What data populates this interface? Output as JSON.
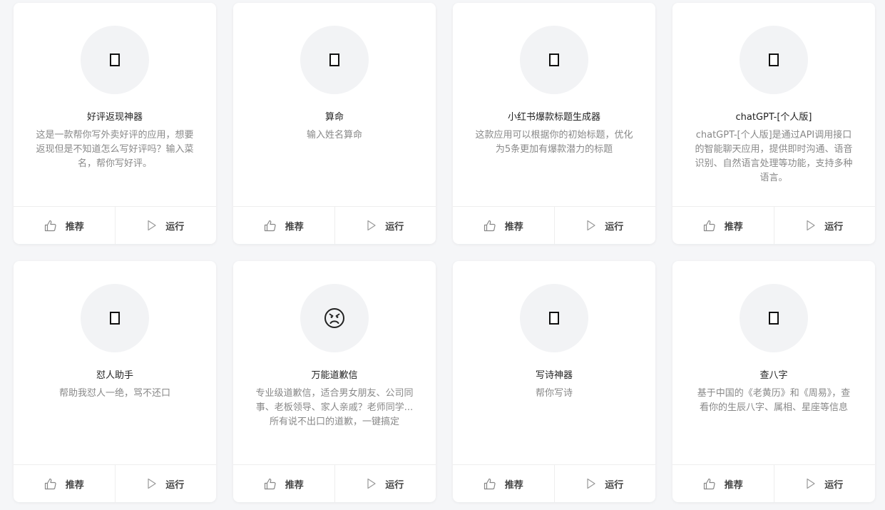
{
  "ui": {
    "recommend_label": "推荐",
    "run_label": "运行",
    "accent": "#f2f3f5"
  },
  "apps": [
    {
      "title": "好评返现神器",
      "desc": "这是一款帮你写外卖好评的应用，想要返现但是不知道怎么写好评吗？输入菜名，帮你写好评。",
      "icon": "emoji-icon"
    },
    {
      "title": "算命",
      "desc": "输入姓名算命",
      "icon": "emoji-icon"
    },
    {
      "title": "小红书爆款标题生成器",
      "desc": "这款应用可以根据你的初始标题，优化为5条更加有爆款潜力的标题",
      "icon": "emoji-icon"
    },
    {
      "title": "chatGPT-[个人版]",
      "desc": "chatGPT-[个人版]是通过API调用接口的智能聊天应用，提供即时沟通、语音识别、自然语言处理等功能，支持多种语言。",
      "icon": "emoji-icon"
    },
    {
      "title": "怼人助手",
      "desc": "帮助我怼人一绝，骂不还口",
      "icon": "emoji-icon"
    },
    {
      "title": "万能道歉信",
      "desc": "专业级道歉信，适合男女朋友、公司同事、老板领导、家人亲戚？老师同学...所有说不出口的道歉，一键搞定",
      "icon": "sad-face-icon"
    },
    {
      "title": "写诗神器",
      "desc": "帮你写诗",
      "icon": "emoji-icon"
    },
    {
      "title": "查八字",
      "desc": "基于中国的《老黄历》和《周易》，查看你的生辰八字、属相、星座等信息",
      "icon": "emoji-icon"
    }
  ]
}
